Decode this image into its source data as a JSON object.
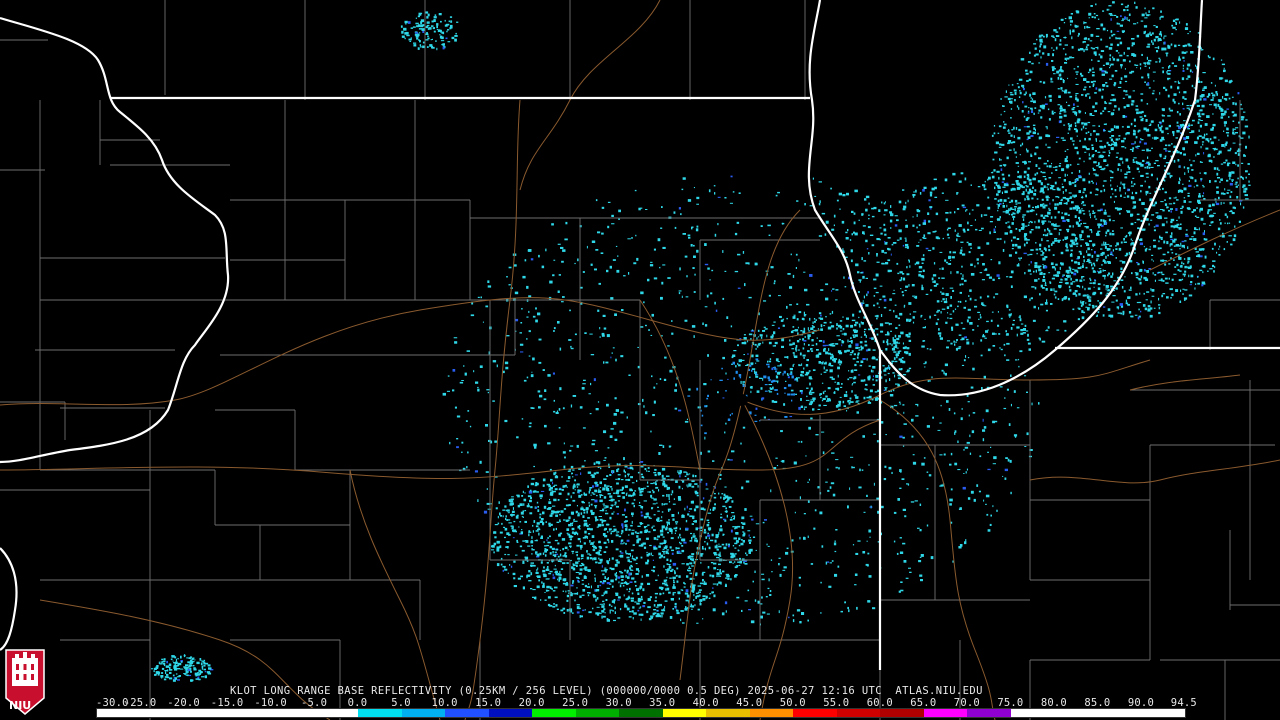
{
  "product": {
    "caption": "KLOT LONG RANGE BASE REFLECTIVITY (0.25KM / 256 LEVEL) (000000/0000 0.5 DEG) 2025-06-27 12:16 UTC  ATLAS.NIU.EDU",
    "radar_site": "KLOT",
    "timestamp": "2025-06-27 12:16 UTC",
    "source": "ATLAS.NIU.EDU"
  },
  "scale": {
    "labels": [
      "-30.0",
      "-25.0",
      "-20.0",
      "-15.0",
      "-10.0",
      "-5.0",
      "0.0",
      "5.0",
      "10.0",
      "15.0",
      "20.0",
      "25.0",
      "30.0",
      "35.0",
      "40.0",
      "45.0",
      "50.0",
      "55.0",
      "60.0",
      "65.0",
      "70.0",
      "75.0",
      "80.0",
      "85.0",
      "90.0",
      "94.5"
    ],
    "colors": [
      "#ffffff",
      "#ffffff",
      "#ffffff",
      "#ffffff",
      "#ffffff",
      "#ffffff",
      "#00e0f0",
      "#00b0f0",
      "#2050ff",
      "#0010c0",
      "#00f000",
      "#00b000",
      "#007000",
      "#ffff00",
      "#e8c000",
      "#ff9000",
      "#ff0000",
      "#d00000",
      "#b00000",
      "#ff00ff",
      "#9000d0",
      "#ffffff",
      "#ffffff",
      "#ffffff",
      "#ffffff"
    ]
  },
  "logo": {
    "text": "NIU",
    "name": "niu-logo"
  },
  "colors": {
    "background": "#000000",
    "state_border": "#ffffff",
    "county_border": "#6e6e6e",
    "road": "#8a5a2e",
    "echo_light": "#2fd8e8",
    "echo_mid": "#1e8ff0",
    "echo_strong": "#2a5cf0"
  }
}
